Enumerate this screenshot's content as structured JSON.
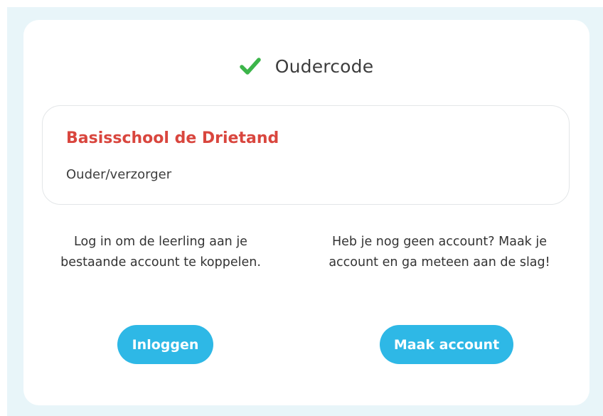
{
  "header": {
    "title": "Oudercode",
    "icon": "check-icon",
    "icon_color": "#3cb54a"
  },
  "school": {
    "name": "Basisschool de Drietand",
    "role": "Ouder/verzorger",
    "name_color": "#d9463e"
  },
  "login_section": {
    "text": "Log in om de leerling aan je bestaande account te koppelen.",
    "button_label": "Inloggen"
  },
  "create_section": {
    "text": "Heb je nog geen account? Maak je account en ga meteen aan de slag!",
    "button_label": "Maak account"
  },
  "colors": {
    "accent": "#2eb8e6",
    "background": "#e8f5f9"
  }
}
